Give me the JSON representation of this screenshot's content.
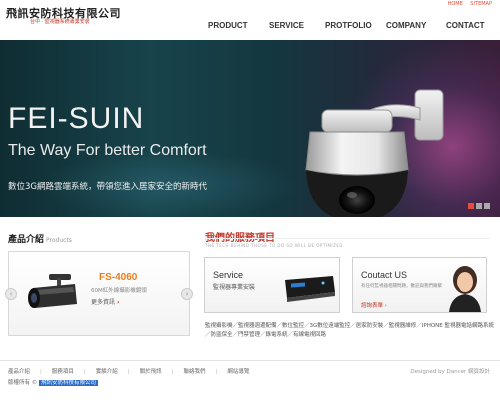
{
  "header": {
    "logo_title": "飛訊安防科技有限公司",
    "logo_subtitle": "台中 · 監視器系統專業安裝",
    "top_links": [
      "HOME",
      "SITEMAP"
    ],
    "nav": [
      "PRODUCT",
      "SERVICE",
      "PROTFOLIO",
      "COMPANY",
      "CONTACT"
    ]
  },
  "banner": {
    "brand": "FEI-SUIN",
    "tagline": "The Way For better Comfort",
    "slogan": "數位3G網路雲端系統，帶領您進入居家安全的新時代"
  },
  "products": {
    "title": "產品介紹",
    "title_en": "Products",
    "model": "FS-4060",
    "desc": "60M紅外線攝影機鏡頭",
    "more": "更多資訊"
  },
  "services": {
    "title": "我們的服務項目",
    "subtitle": "THE TECH BEHIND THOSE TO DO SO WILL BE OPTIMIZED.",
    "service_box": {
      "title": "Service",
      "subtitle": "監視器專業安裝"
    },
    "contact_box": {
      "title": "Coutact US",
      "desc": "有任何監視器相關問題，歡迎與我們聯繫",
      "link": "諮詢表單"
    },
    "text": "監視攝影機／監視器週邊配備／數位監控／3G數位遠端監控／居家防安裝／監視器維修／IPHONE 監視器電話網路系統／防盜保全／門禁管理／錄電系統／有線電視回路"
  },
  "footer": {
    "nav": [
      "產品介紹",
      "服務項目",
      "實績介紹",
      "關於飛訊",
      "聯絡我們",
      "網站導覽"
    ],
    "credit": "Designed by Dancer 網頁設計",
    "copyright_prefix": "版權所有 ©",
    "company": "飛訊安防科技有限公司"
  },
  "colors": {
    "accent": "#c0392b",
    "product_model": "#e67e22",
    "banner_bg": "#18434b"
  }
}
